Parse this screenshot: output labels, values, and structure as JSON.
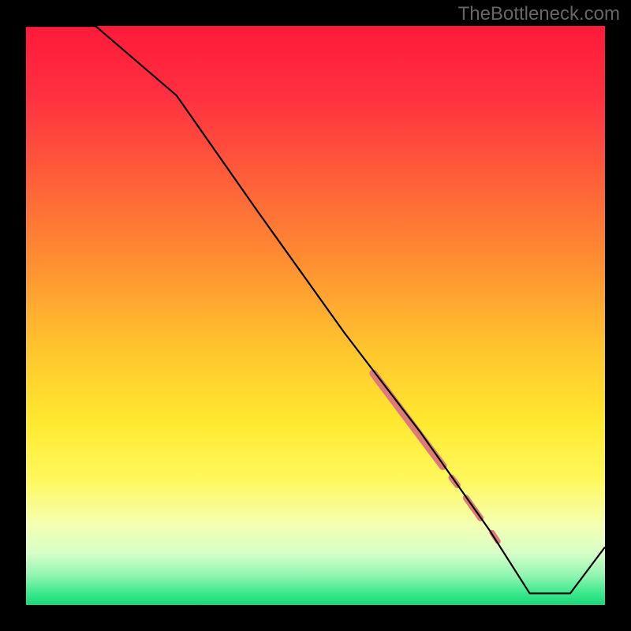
{
  "watermark": "TheBottleneck.com",
  "chart_data": {
    "type": "line",
    "title": "",
    "xlabel": "",
    "ylabel": "",
    "xlim": [
      0,
      100
    ],
    "ylim": [
      0,
      100
    ],
    "note": "Background is a vertical gradient from green (bottom, good) through yellow to red (top, high bottleneck). Black curve descends from 100% at left to ~0% near right then rises slightly. Pink segments highlight a region of the curve.",
    "line": {
      "points": [
        {
          "x": 0.0,
          "y": 100.0
        },
        {
          "x": 12.0,
          "y": 100.0
        },
        {
          "x": 26.0,
          "y": 88.0
        },
        {
          "x": 40.0,
          "y": 68.0
        },
        {
          "x": 55.0,
          "y": 47.0
        },
        {
          "x": 68.0,
          "y": 30.0
        },
        {
          "x": 80.0,
          "y": 13.0
        },
        {
          "x": 87.0,
          "y": 2.0
        },
        {
          "x": 94.0,
          "y": 2.0
        },
        {
          "x": 100.0,
          "y": 10.0
        }
      ]
    },
    "highlight_segments": [
      {
        "x1": 60.0,
        "y1": 40.0,
        "x2": 72.0,
        "y2": 24.0,
        "width": 10
      },
      {
        "x1": 73.5,
        "y1": 22.0,
        "x2": 74.5,
        "y2": 20.7,
        "width": 8
      },
      {
        "x1": 76.0,
        "y1": 18.5,
        "x2": 78.5,
        "y2": 15.0,
        "width": 8
      },
      {
        "x1": 80.5,
        "y1": 12.5,
        "x2": 81.5,
        "y2": 11.0,
        "width": 7
      }
    ],
    "gradient_stops": [
      {
        "pos": 0.0,
        "color": "#ff1a3a"
      },
      {
        "pos": 0.12,
        "color": "#ff3040"
      },
      {
        "pos": 0.25,
        "color": "#ff5a3a"
      },
      {
        "pos": 0.4,
        "color": "#ff8c32"
      },
      {
        "pos": 0.55,
        "color": "#ffc22e"
      },
      {
        "pos": 0.68,
        "color": "#ffe82e"
      },
      {
        "pos": 0.78,
        "color": "#fff85a"
      },
      {
        "pos": 0.86,
        "color": "#f5ffb0"
      },
      {
        "pos": 0.91,
        "color": "#d8ffc8"
      },
      {
        "pos": 0.95,
        "color": "#8ef5b0"
      },
      {
        "pos": 0.98,
        "color": "#3ae88c"
      },
      {
        "pos": 1.0,
        "color": "#18d878"
      }
    ]
  }
}
